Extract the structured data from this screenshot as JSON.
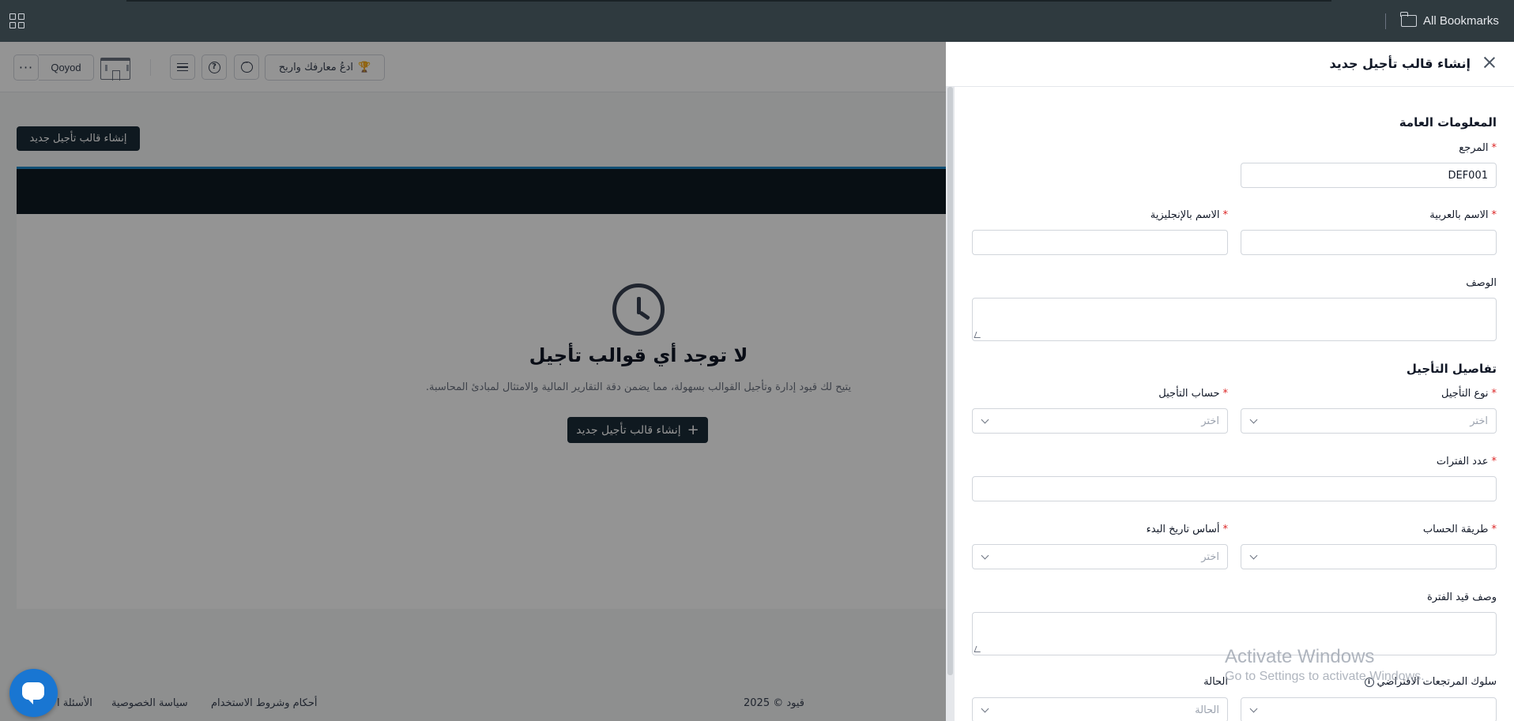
{
  "browser": {
    "bookmarks_label": "All Bookmarks"
  },
  "app": {
    "header": {
      "more_label": "···",
      "org_label": "Qoyod",
      "refer_label": "ادعُ معارفك واربح"
    },
    "create_small_label": "إنشاء قالب تأجيل جديد",
    "empty": {
      "title": "لا توجد أي قوالب تأجيل",
      "description": "يتيح لك قيود إدارة وتأجيل القوالب بسهولة، مما يضمن دقة التقارير المالية والامتثال لمبادئ المحاسبة.",
      "create_label": "إنشاء قالب تأجيل جديد",
      "plus": "+"
    },
    "footer": {
      "copyright": "قيود © 2025",
      "terms": "أحكام وشروط الاستخدام",
      "privacy": "سياسة الخصوصية",
      "faq": "الأسئلة ا"
    }
  },
  "drawer": {
    "title": "إنشاء قالب تأجيل جديد",
    "section_general": "المعلومات العامة",
    "section_details": "تفاصيل التأجيل",
    "required_mark": "*",
    "select_placeholder": "اختر",
    "fields": {
      "reference": {
        "label": "المرجع",
        "value": "DEF001"
      },
      "name_ar": {
        "label": "الاسم بالعربية",
        "value": ""
      },
      "name_en": {
        "label": "الاسم بالإنجليزية",
        "value": ""
      },
      "description": {
        "label": "الوصف",
        "value": ""
      },
      "deferral_type": {
        "label": "نوع التأجيل"
      },
      "deferral_account": {
        "label": "حساب التأجيل"
      },
      "periods": {
        "label": "عدد الفترات",
        "value": ""
      },
      "calc_method": {
        "label": "طريقة الحساب"
      },
      "start_basis": {
        "label": "أساس تاريخ البدء"
      },
      "period_entry_desc": {
        "label": "وصف قيد الفترة",
        "value": ""
      },
      "default_returns": {
        "label": "سلوك المرتجعات الافتراضي"
      },
      "status": {
        "label": "الحالة",
        "placeholder": "الحالة"
      }
    }
  },
  "watermark": {
    "line1": "Activate Windows",
    "line2": "Go to Settings to activate Windows."
  }
}
